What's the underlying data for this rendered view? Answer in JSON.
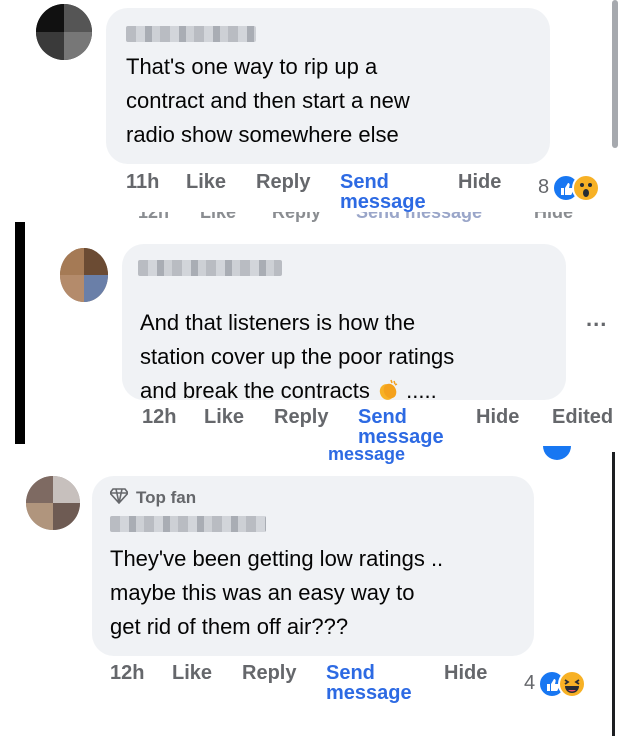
{
  "comments": [
    {
      "text_lines": [
        "That's one way to rip up a",
        "contract and then start a new",
        "radio show somewhere else"
      ],
      "actions": {
        "time": "11h",
        "like": "Like",
        "reply": "Reply",
        "send_line1": "Send",
        "send_line2": "message",
        "hide": "Hide"
      },
      "reactions": {
        "count": "8",
        "icons": [
          "like-icon",
          "wow-icon"
        ]
      }
    },
    {
      "text_lines": [
        "And that listeners is how the",
        "station cover up the poor ratings",
        "and break the contracts"
      ],
      "trailing_text": ".....",
      "trailing_emoji": "clapping-hands-icon",
      "actions": {
        "time": "12h",
        "like": "Like",
        "reply": "Reply",
        "send_line1": "Send",
        "send_line2": "message",
        "hide": "Hide",
        "edited": "Edited"
      },
      "more_label": "..."
    },
    {
      "badge": "Top fan",
      "text_lines": [
        "They've been getting low ratings ..",
        "maybe this was an easy way to",
        "get rid of them off air???"
      ],
      "actions": {
        "time": "12h",
        "like": "Like",
        "reply": "Reply",
        "send_line1": "Send",
        "send_line2": "message",
        "hide": "Hide"
      },
      "reactions": {
        "count": "4",
        "icons": [
          "like-icon",
          "haha-icon"
        ]
      }
    }
  ],
  "ghost_rows": {
    "row1": {
      "time": "12h",
      "like": "Like",
      "reply": "Reply",
      "send": "Send message",
      "hide": "Hide"
    },
    "row2": {
      "send": "message"
    }
  },
  "colors": {
    "link": "#2d6ae3",
    "meta": "#65676b",
    "bubble": "#f0f2f5",
    "like": "#1877f2",
    "emoji": "#f7b125"
  }
}
